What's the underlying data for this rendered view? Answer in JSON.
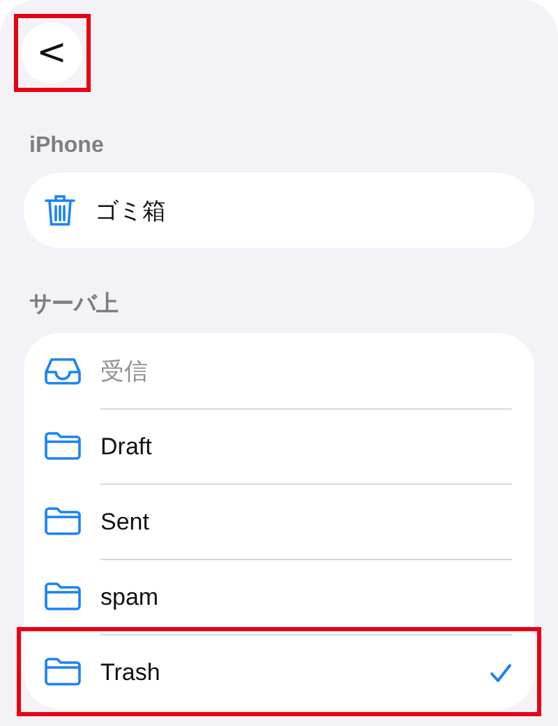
{
  "back_button": {
    "label": "<",
    "highlighted": true
  },
  "sections": [
    {
      "title": "iPhone",
      "items": [
        {
          "label": "ゴミ箱",
          "kind": "trash",
          "disabled": false,
          "selected": false
        }
      ]
    },
    {
      "title": "サーバ上",
      "items": [
        {
          "label": "受信",
          "kind": "inbox",
          "disabled": true,
          "selected": false
        },
        {
          "label": "Draft",
          "kind": "folder",
          "disabled": false,
          "selected": false
        },
        {
          "label": "Sent",
          "kind": "folder",
          "disabled": false,
          "selected": false
        },
        {
          "label": "spam",
          "kind": "folder",
          "disabled": false,
          "selected": false
        },
        {
          "label": "Trash",
          "kind": "folder",
          "disabled": false,
          "selected": true,
          "highlighted": true
        }
      ]
    }
  ]
}
